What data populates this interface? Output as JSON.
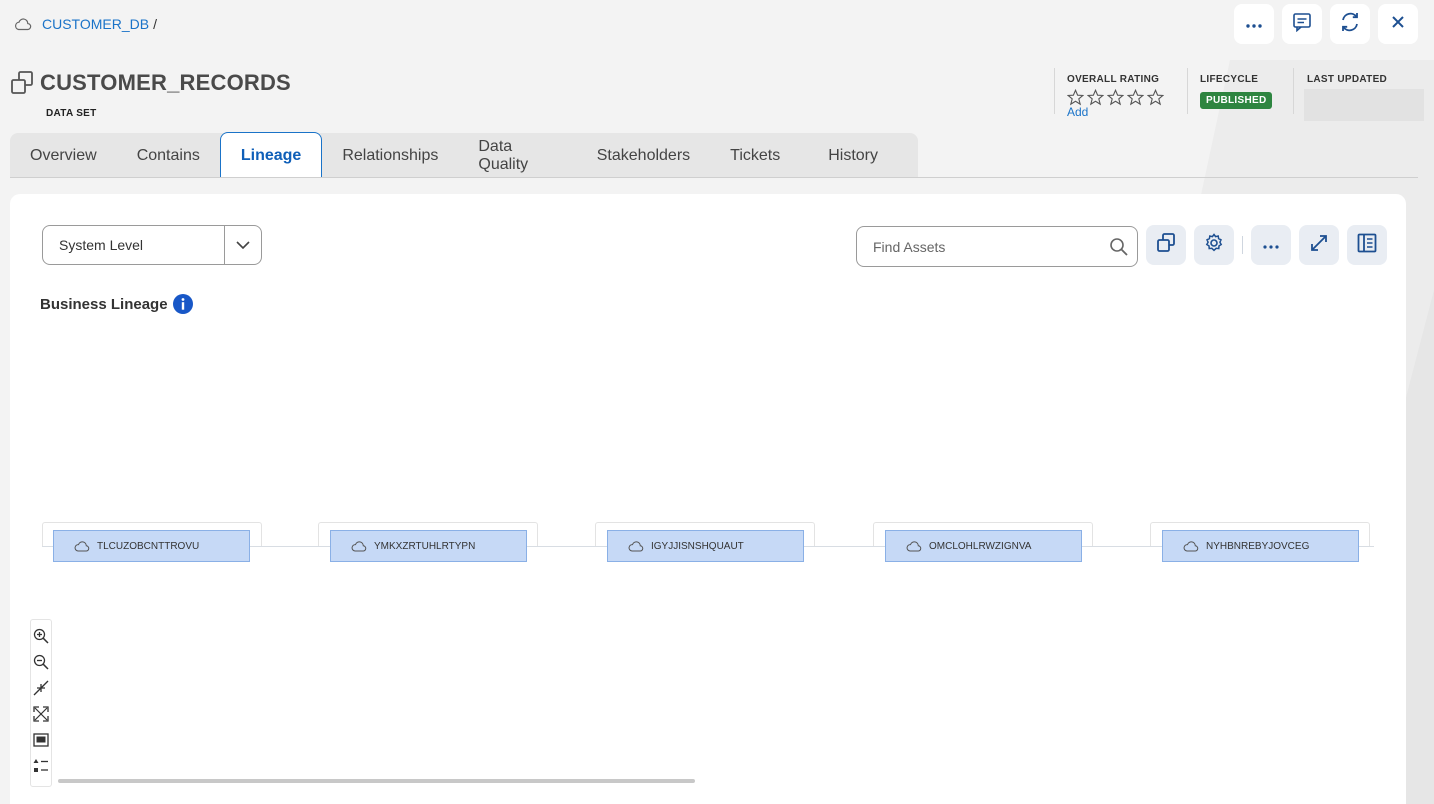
{
  "breadcrumb": {
    "parent": "CUSTOMER_DB",
    "separator": "/"
  },
  "header": {
    "title": "CUSTOMER_RECORDS",
    "type_label": "DATA SET",
    "actions": [
      "more-icon",
      "comment-icon",
      "refresh-icon",
      "close-icon"
    ]
  },
  "meta": {
    "overall_rating_label": "OVERALL RATING",
    "rating_value": 0,
    "rating_max": 5,
    "add_label": "Add",
    "lifecycle_label": "LIFECYCLE",
    "lifecycle_status": "PUBLISHED",
    "last_updated_label": "LAST UPDATED"
  },
  "tabs": [
    {
      "label": "Overview"
    },
    {
      "label": "Contains"
    },
    {
      "label": "Lineage",
      "active": true
    },
    {
      "label": "Relationships"
    },
    {
      "label": "Data Quality"
    },
    {
      "label": "Stakeholders"
    },
    {
      "label": "Tickets"
    },
    {
      "label": "History"
    }
  ],
  "lineage": {
    "level_select": "System Level",
    "search_placeholder": "Find Assets",
    "section_title": "Business Lineage",
    "nodes": [
      {
        "label": "TLCUZOBCNTTROVU"
      },
      {
        "label": "YMKXZRTUHLRTYPN"
      },
      {
        "label": "IGYJJISNSHQUAUT"
      },
      {
        "label": "OMCLOHLRWZIGNVA"
      },
      {
        "label": "NYHBNREBYJOVCEG"
      }
    ]
  },
  "colors": {
    "accent": "#1a73c8",
    "published": "#2e8540",
    "node_fill": "#c6d9f6",
    "node_border": "#8ab0e6"
  }
}
